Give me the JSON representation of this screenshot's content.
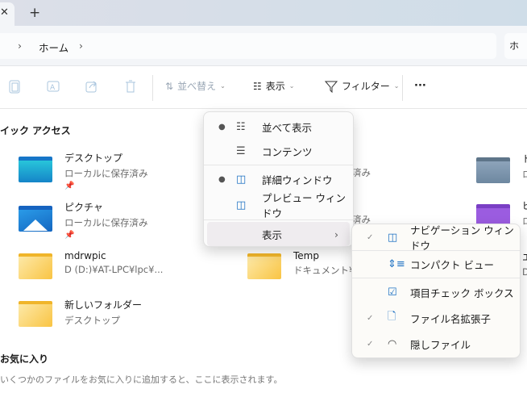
{
  "tabs": {
    "close": "✕",
    "new_tab": "+"
  },
  "address": {
    "crumbs": [
      "›",
      "ホーム",
      "›"
    ],
    "search_partial": "ホ"
  },
  "toolbar": {
    "sort": "並べ替え",
    "view": "表示",
    "filter": "フィルター",
    "more": "···"
  },
  "quick_access": {
    "title": "イック アクセス",
    "items": [
      {
        "name": "デスクトップ",
        "sub": "ローカルに保存済み",
        "pinned": true
      },
      {
        "name": "ピクチャ",
        "sub": "ローカルに保存済み",
        "pinned": true
      },
      {
        "name": "mdrwpic",
        "sub": "D (D:)¥AT-LPC¥lpc¥..."
      },
      {
        "name": "Temp",
        "sub": "ドキュメント¥We"
      },
      {
        "name": "新しいフォルダー",
        "sub": "デスクトップ"
      }
    ],
    "col2_partial_subs": [
      "済み",
      "済み"
    ],
    "col3_partial": [
      {
        "name": "ド",
        "sub": "ロ"
      },
      {
        "name": "ビ",
        "sub": "ロ"
      },
      {
        "name": "エ",
        "sub": "D"
      }
    ]
  },
  "favorites": {
    "title": "お気に入り",
    "desc": "いくつかのファイルをお気に入りに追加すると、ここに表示されます。"
  },
  "view_menu": {
    "items": [
      {
        "label": "並べて表示",
        "selected": true
      },
      {
        "label": "コンテンツ",
        "selected": false
      },
      {
        "label": "詳細ウィンドウ",
        "selected": true
      },
      {
        "label": "プレビュー ウィンドウ",
        "selected": false
      },
      {
        "label": "表示",
        "submenu": true,
        "arrow": "›"
      }
    ]
  },
  "show_submenu": {
    "items": [
      {
        "label": "ナビゲーション ウィンドウ",
        "checked": true
      },
      {
        "label": "コンパクト ビュー",
        "checked": false
      },
      {
        "label": "項目チェック ボックス",
        "checked": false
      },
      {
        "label": "ファイル名拡張子",
        "checked": true
      },
      {
        "label": "隠しファイル",
        "checked": true
      }
    ],
    "check": "✓"
  }
}
